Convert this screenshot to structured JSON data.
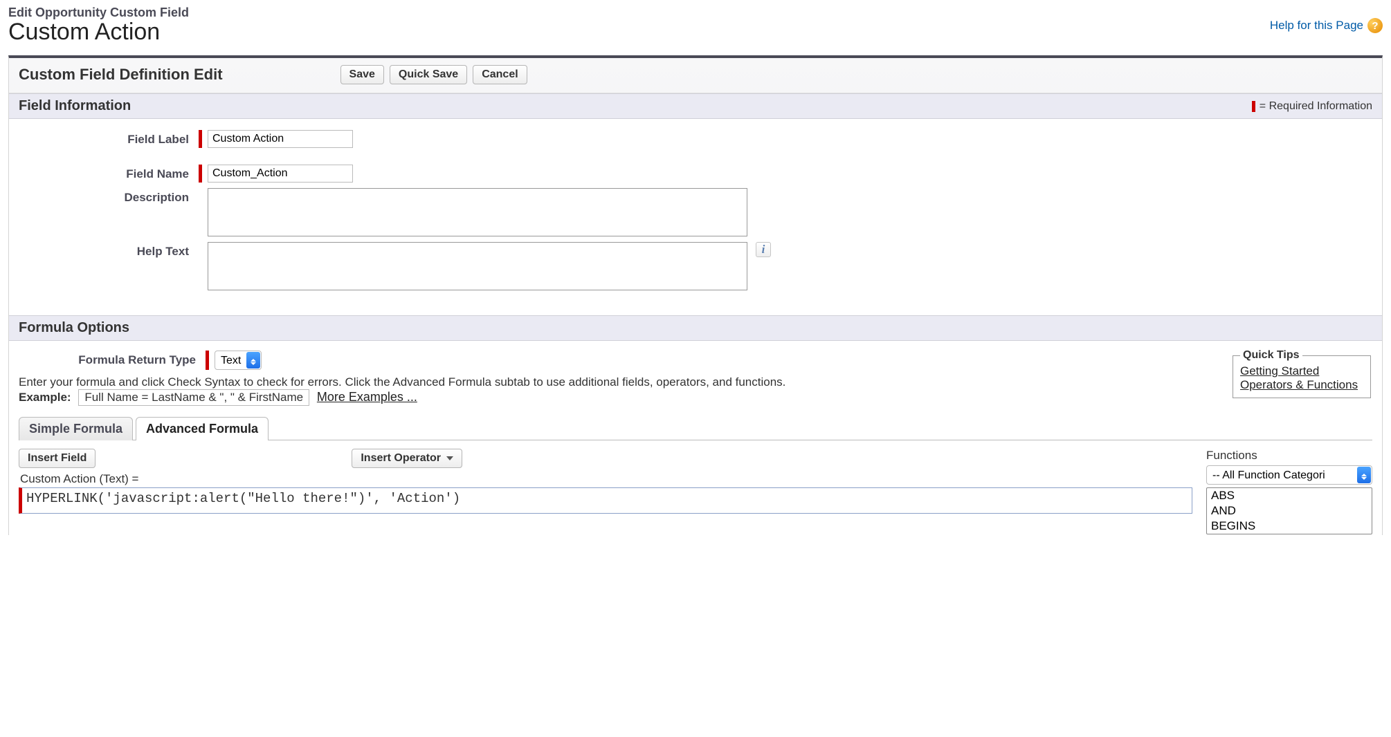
{
  "header": {
    "super": "Edit Opportunity Custom Field",
    "title": "Custom Action",
    "help_link": "Help for this Page"
  },
  "panel": {
    "title": "Custom Field Definition Edit",
    "buttons": {
      "save": "Save",
      "quick_save": "Quick Save",
      "cancel": "Cancel"
    }
  },
  "section_field_info": {
    "title": "Field Information",
    "required_note": "= Required Information",
    "labels": {
      "field_label": "Field Label",
      "field_name": "Field Name",
      "description": "Description",
      "help_text": "Help Text"
    },
    "values": {
      "field_label": "Custom Action",
      "field_name": "Custom_Action",
      "description": "",
      "help_text": ""
    }
  },
  "section_formula": {
    "title": "Formula Options",
    "return_type_label": "Formula Return Type",
    "return_type_value": "Text",
    "intro": "Enter your formula and click Check Syntax to check for errors. Click the Advanced Formula subtab to use additional fields, operators, and functions.",
    "example_label": "Example:",
    "example_value": "Full Name = LastName & \", \" & FirstName",
    "more_examples": "More Examples ...",
    "quick_tips": {
      "legend": "Quick Tips",
      "links": [
        "Getting Started",
        "Operators & Functions"
      ]
    },
    "tabs": {
      "simple": "Simple Formula",
      "advanced": "Advanced Formula"
    },
    "toolbar": {
      "insert_field": "Insert Field",
      "insert_operator": "Insert Operator"
    },
    "editor_label": "Custom Action (Text) =",
    "formula": "HYPERLINK('javascript:alert(\"Hello there!\")', 'Action')",
    "functions": {
      "label": "Functions",
      "category": "-- All Function Categori",
      "list": [
        "ABS",
        "AND",
        "BEGINS"
      ]
    }
  }
}
